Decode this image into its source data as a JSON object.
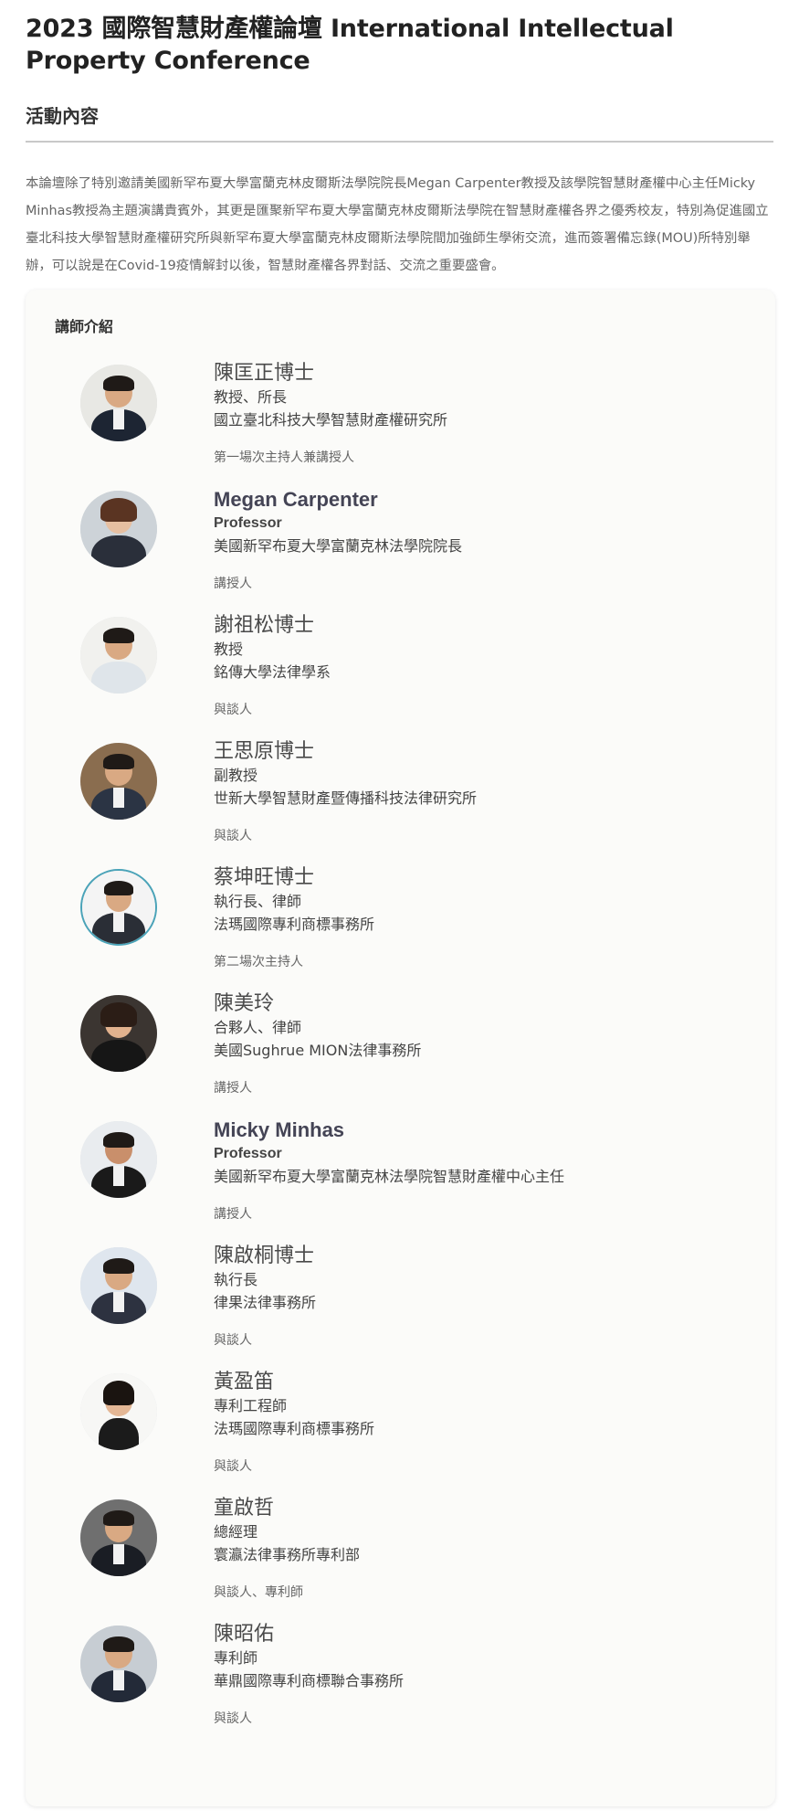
{
  "page": {
    "title": "2023 國際智慧財產權論壇 International Intellectual Property Conference",
    "section_heading": "活動內容",
    "intro": "本論壇除了特別邀請美國新罕布夏大學富蘭克林皮爾斯法學院院長Megan Carpenter教授及該學院智慧財產權中心主任Micky Minhas教授為主題演講貴賓外，其更是匯聚新罕布夏大學富蘭克林皮爾斯法學院在智慧財產權各界之優秀校友，特別為促進國立臺北科技大學智慧財產權研究所與新罕布夏大學富蘭克林皮爾斯法學院間加強師生學術交流，進而簽署備忘錄(MOU)所特別舉辦，可以說是在Covid-19疫情解封以後，智慧財產權各界對話、交流之重要盛會。"
  },
  "speakers_panel": {
    "title": "講師介紹",
    "speakers": [
      {
        "name": "陳匡正博士",
        "position": "教授、所長",
        "org": "國立臺北科技大學智慧財產權研究所",
        "role": "第一場次主持人兼講授人"
      },
      {
        "name": "Megan Carpenter",
        "position": "Professor",
        "org": "美國新罕布夏大學富蘭克林法學院院長",
        "role": "講授人"
      },
      {
        "name": "謝祖松博士",
        "position": "教授",
        "org": "銘傳大學法律學系",
        "role": "與談人"
      },
      {
        "name": "王思原博士",
        "position": "副教授",
        "org": "世新大學智慧財產暨傳播科技法律研究所",
        "role": "與談人"
      },
      {
        "name": "蔡坤旺博士",
        "position": "執行長、律師",
        "org": "法瑪國際專利商標事務所",
        "role": "第二場次主持人"
      },
      {
        "name": "陳美玲",
        "position": "合夥人、律師",
        "org": "美國Sughrue MION法律事務所",
        "role": "講授人"
      },
      {
        "name": "Micky Minhas",
        "position": "Professor",
        "org": "美國新罕布夏大學富蘭克林法學院智慧財產權中心主任",
        "role": "講授人"
      },
      {
        "name": "陳啟桐博士",
        "position": "執行長",
        "org": "律果法律事務所",
        "role": "與談人"
      },
      {
        "name": "黃盈笛",
        "position": "專利工程師",
        "org": "法瑪國際專利商標事務所",
        "role": "與談人"
      },
      {
        "name": "童啟哲",
        "position": "總經理",
        "org": "寰瀛法律事務所專利部",
        "role": "與談人、專利師"
      },
      {
        "name": "陳昭佑",
        "position": "專利師",
        "org": "華鼎國際專利商標聯合事務所",
        "role": "與談人"
      }
    ]
  }
}
